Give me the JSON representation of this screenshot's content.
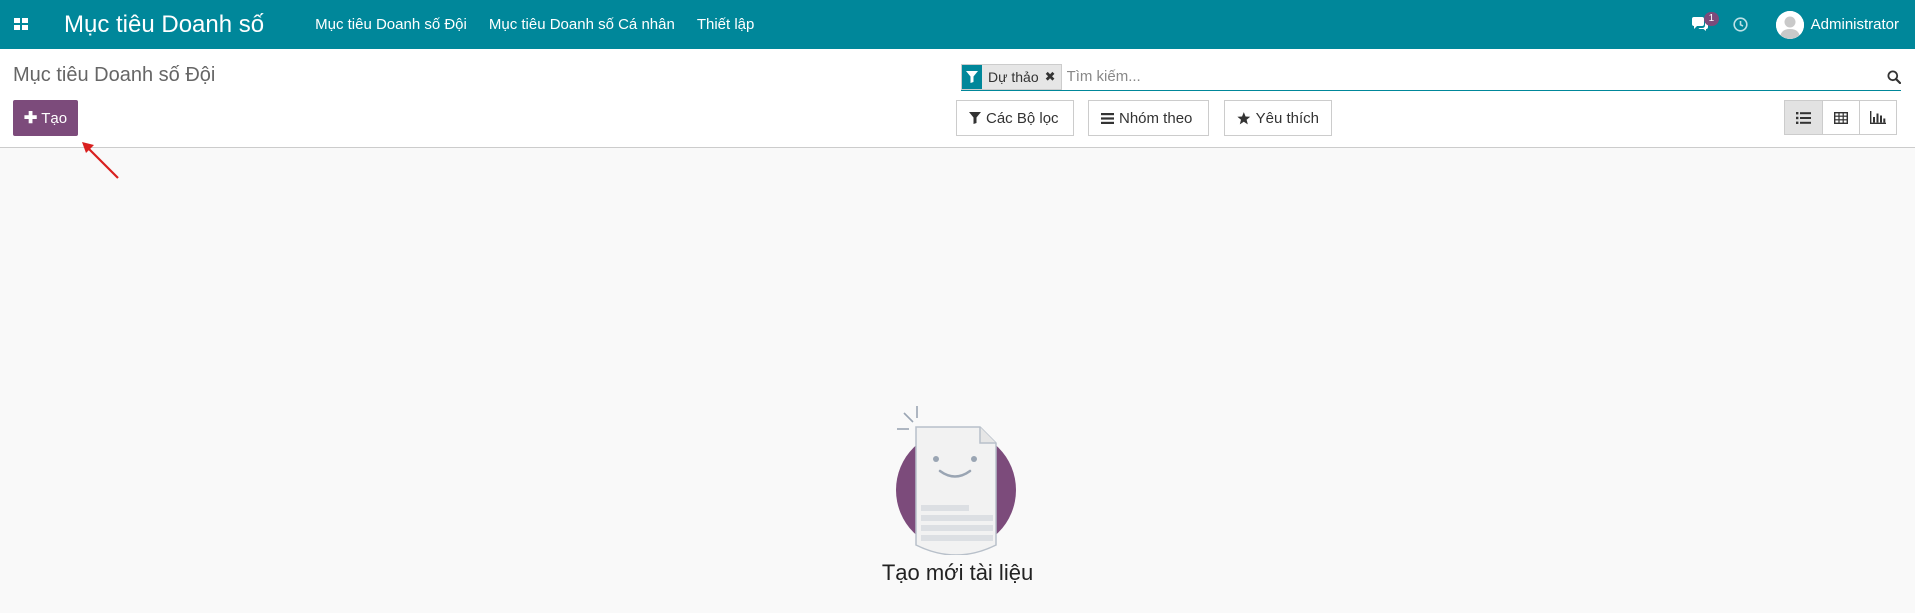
{
  "navbar": {
    "app_title": "Mục tiêu Doanh số",
    "menu": [
      {
        "label": "Mục tiêu Doanh số Đội"
      },
      {
        "label": "Mục tiêu Doanh số Cá nhân"
      },
      {
        "label": "Thiết lập"
      }
    ],
    "messages_count": "1",
    "user_name": "Administrator",
    "colors": {
      "navbar_bg": "#00879a",
      "badge_bg": "#7c4b7b"
    }
  },
  "control_panel": {
    "title": "Mục tiêu Doanh số Đội",
    "create_label": "Tạo",
    "search": {
      "facet_value": "Dự thảo",
      "placeholder": "Tìm kiếm..."
    },
    "filters_label": "Các Bộ lọc",
    "groupby_label": "Nhóm theo",
    "favorites_label": "Yêu thích",
    "views": [
      {
        "icon": "list-icon",
        "active": true
      },
      {
        "icon": "pivot-table-icon",
        "active": false
      },
      {
        "icon": "bar-chart-icon",
        "active": false
      }
    ],
    "colors": {
      "primary_button": "#7c4b7b"
    }
  },
  "empty_state": {
    "title": "Tạo mới tài liệu"
  }
}
